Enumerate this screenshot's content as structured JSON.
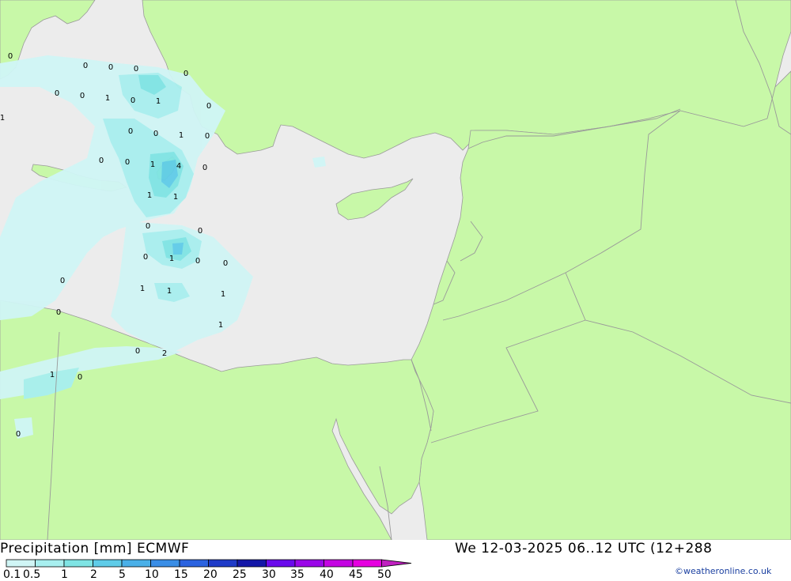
{
  "header": {
    "title": "Precipitation [mm] ECMWF",
    "validity": "We 12-03-2025 06..12 UTC (12+288",
    "credit": "©weatheronline.co.uk"
  },
  "colors": {
    "sea": "#ececec",
    "land": "#c8f8a8",
    "border": "#999999",
    "coast": "#9a9a9a"
  },
  "legend": {
    "levels": [
      {
        "label": "0.1",
        "color": "#d0f5f5"
      },
      {
        "label": "0.5",
        "color": "#a8efef"
      },
      {
        "label": "1",
        "color": "#7fe4e4"
      },
      {
        "label": "2",
        "color": "#5fcce8"
      },
      {
        "label": "5",
        "color": "#4ab0e8"
      },
      {
        "label": "10",
        "color": "#3a8ee6"
      },
      {
        "label": "15",
        "color": "#2b63e0"
      },
      {
        "label": "20",
        "color": "#1f3bc8"
      },
      {
        "label": "25",
        "color": "#1417a8"
      },
      {
        "label": "30",
        "color": "#6a0aec"
      },
      {
        "label": "35",
        "color": "#9a06e8"
      },
      {
        "label": "40",
        "color": "#c404e2"
      },
      {
        "label": "45",
        "color": "#e600e0"
      },
      {
        "label": "50",
        "color": "#c020c0"
      }
    ]
  },
  "map_labels": [
    "0",
    "0",
    "0",
    "0",
    "0",
    "0",
    "0",
    "1",
    "0",
    "1",
    "0",
    "1",
    "0",
    "0",
    "1",
    "0",
    "0",
    "0",
    "1",
    "4",
    "0",
    "1",
    "1",
    "0",
    "0",
    "0",
    "1",
    "0",
    "0",
    "0",
    "1",
    "1",
    "1",
    "1",
    "0",
    "0",
    "2",
    "1",
    "0",
    "0"
  ]
}
